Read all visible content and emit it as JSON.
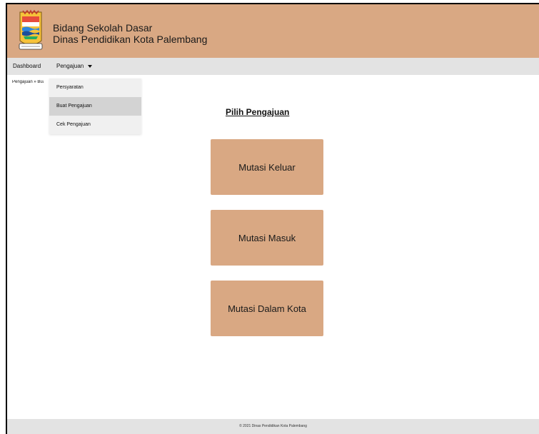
{
  "header": {
    "line1": "Bidang Sekolah Dasar",
    "line2": "Dinas Pendidikan Kota Palembang",
    "logo_icon": "palembang-city-emblem",
    "bg_color": "#d9a883"
  },
  "nav": {
    "dashboard": "Dashboard",
    "pengajuan": "Pengajuan",
    "pengajuan_icon": "caret-down-icon"
  },
  "breadcrumb": "Pengajuan » Buat Pengajuan",
  "dropdown": {
    "items": [
      "Persyaratan",
      "Buat Pengajuan",
      "Cek Pengajuan"
    ],
    "active": "Buat Pengajuan"
  },
  "main": {
    "title": "Pilih Pengajuan",
    "cards": [
      "Mutasi Keluar",
      "Mutasi Masuk",
      "Mutasi Dalam Kota"
    ]
  },
  "footer": "© 2021 Dinas Pendidikan Kota Palembang"
}
